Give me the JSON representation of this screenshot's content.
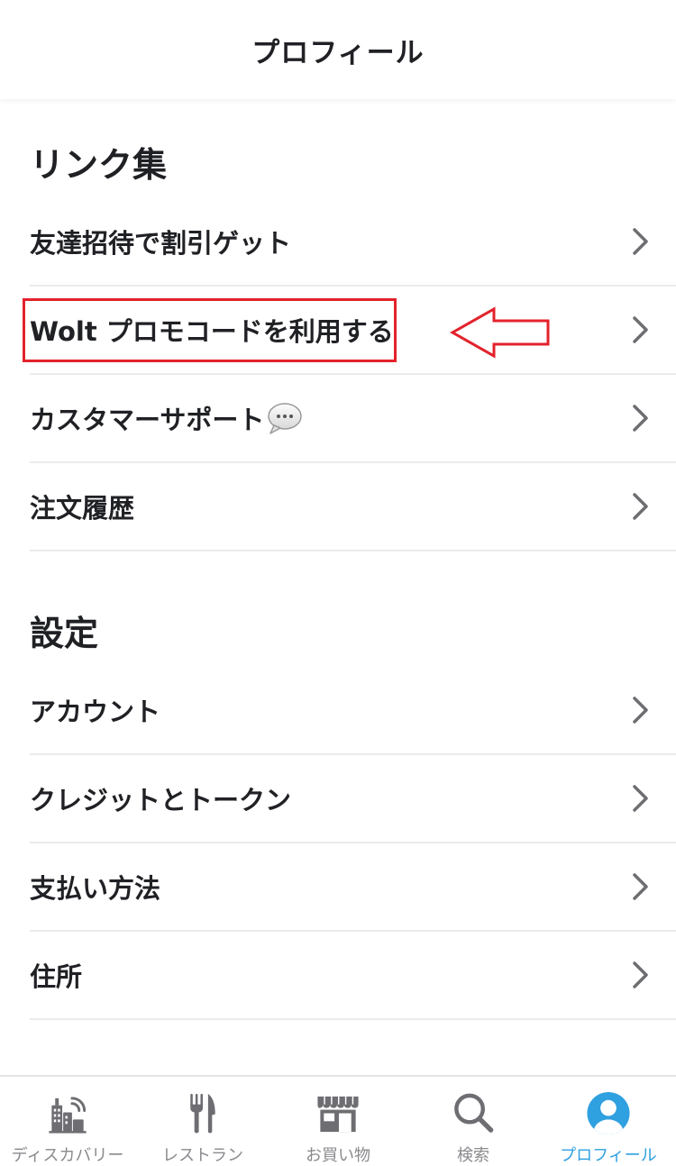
{
  "header": {
    "title": "プロフィール"
  },
  "links_section": {
    "title": "リンク集",
    "items": [
      {
        "label": "友達招待で割引ゲット"
      },
      {
        "label": "Wolt プロモコードを利用する"
      },
      {
        "label": "カスタマーサポート"
      },
      {
        "label": "注文履歴"
      }
    ]
  },
  "settings_section": {
    "title": "設定",
    "items": [
      {
        "label": "アカウント"
      },
      {
        "label": "クレジットとトークン"
      },
      {
        "label": "支払い方法"
      },
      {
        "label": "住所"
      }
    ]
  },
  "tabbar": {
    "tabs": [
      {
        "label": "ディスカバリー",
        "icon": "discovery-city-icon"
      },
      {
        "label": "レストラン",
        "icon": "fork-knife-icon"
      },
      {
        "label": "お買い物",
        "icon": "store-icon"
      },
      {
        "label": "検索",
        "icon": "search-icon"
      },
      {
        "label": "プロフィール",
        "icon": "profile-icon",
        "active": true
      }
    ]
  },
  "colors": {
    "text": "#202125",
    "divider": "#ebebeb",
    "chevron": "#6d6d72",
    "tab_inactive": "#8a8a8e",
    "tab_active": "#2fa0e0",
    "annotation_red": "#e3222b"
  }
}
